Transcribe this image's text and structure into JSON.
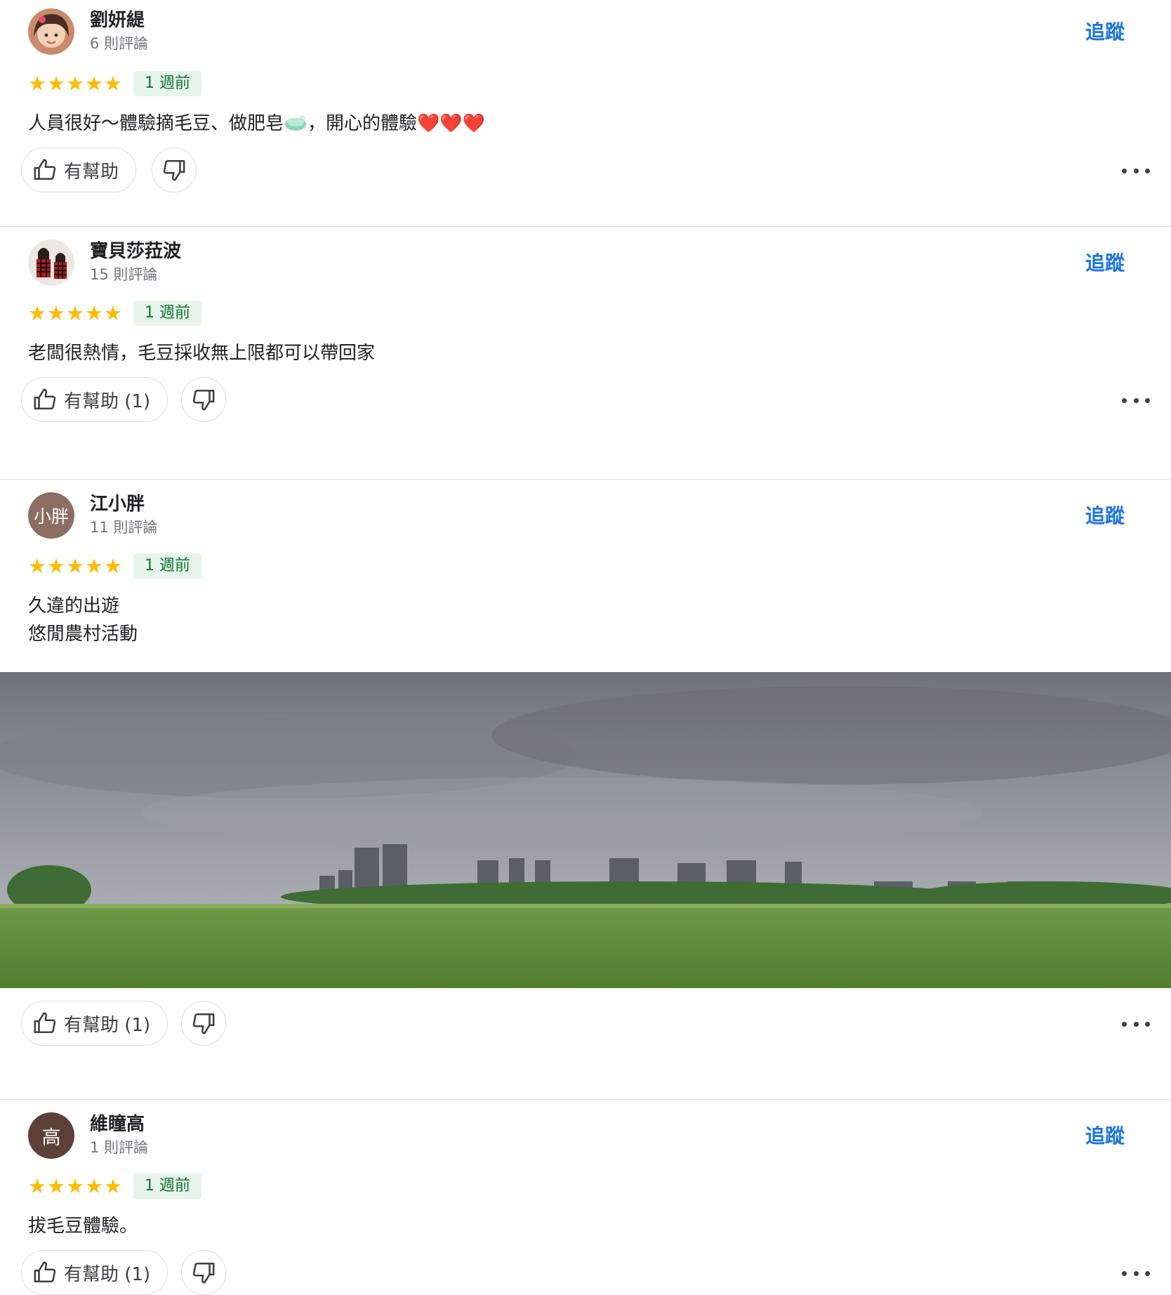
{
  "follow_label": "追蹤",
  "reviews": [
    {
      "name": "劉妍緹",
      "count": "6 則評論",
      "stars": 5,
      "time": "1 週前",
      "text_before": "人員很好～體驗摘毛豆、做肥皂",
      "text_after": "，開心的體驗",
      "emoji_soap": "soap-emoji-icon",
      "hearts": "❤️❤️❤️",
      "helpful_label": "有幫助"
    },
    {
      "name": "寶貝莎菈波",
      "count": "15 則評論",
      "stars": 5,
      "time": "1 週前",
      "text": "老闆很熱情，毛豆採收無上限都可以帶回家",
      "helpful_label": "有幫助 (1)"
    },
    {
      "name": "江小胖",
      "count": "11 則評論",
      "stars": 5,
      "time": "1 週前",
      "avatar_letter": "小胖",
      "lines": [
        "久違的出遊",
        "悠閒農村活動"
      ],
      "helpful_label": "有幫助 (1)"
    },
    {
      "name": "維瞳高",
      "count": "1 則評論",
      "stars": 5,
      "time": "1 週前",
      "avatar_letter": "高",
      "text": "拔毛豆體驗。",
      "helpful_label": "有幫助 (1)"
    }
  ],
  "star_glyph": "★",
  "icons": {
    "thumb_up": "thumb-up-icon",
    "thumb_down": "thumb-down-icon",
    "more": "more-options-icon"
  },
  "colors": {
    "follow": "#1a73e8",
    "star": "#fbbc04",
    "badge_bg": "#e6f4ea",
    "badge_text": "#137333"
  }
}
